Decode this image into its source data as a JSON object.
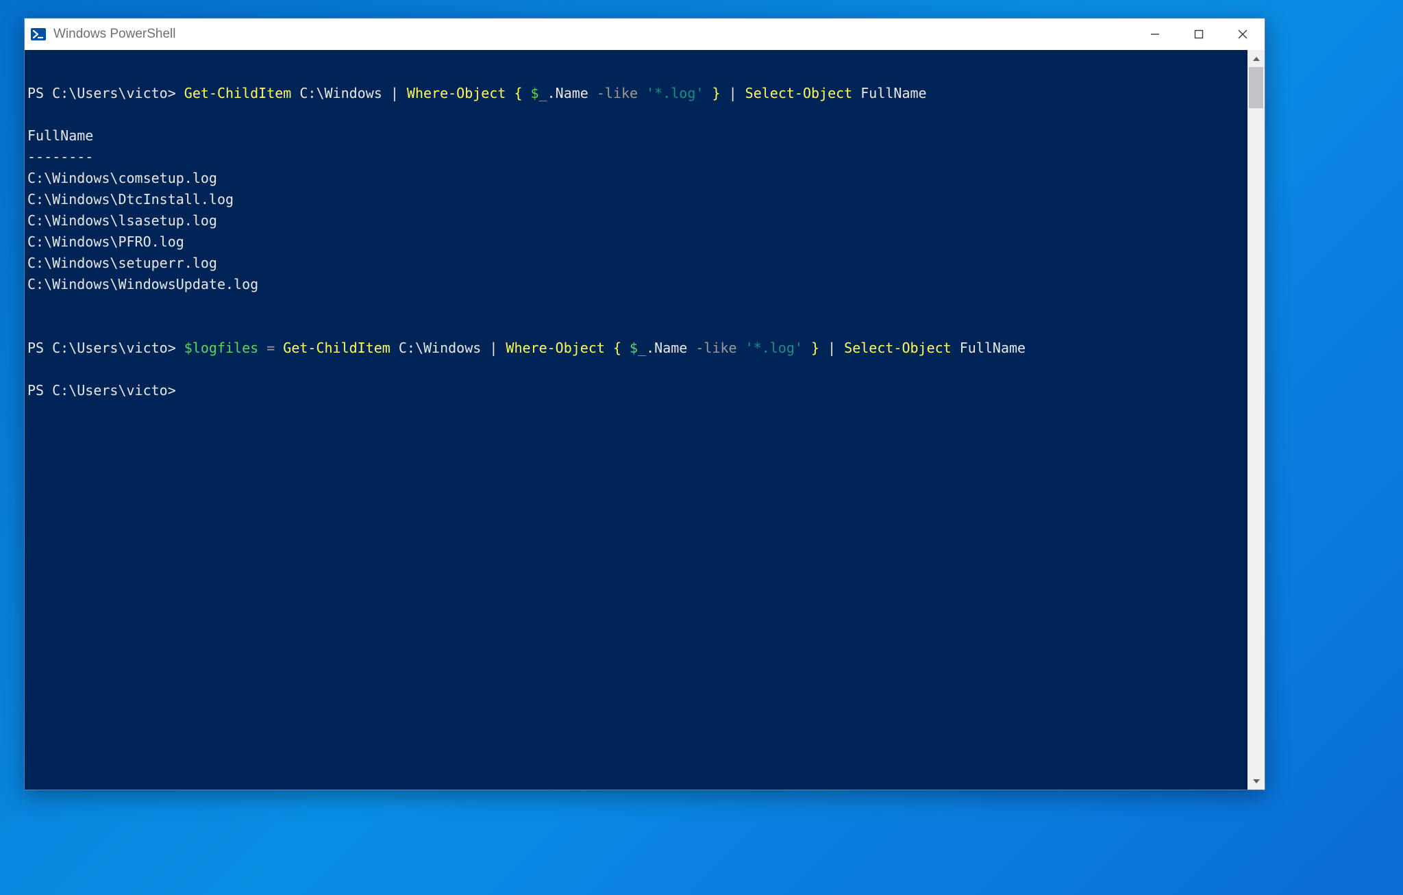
{
  "window": {
    "title": "Windows PowerShell"
  },
  "terminal": {
    "line1": {
      "prompt": "PS C:\\Users\\victo> ",
      "cmd1": "Get-ChildItem",
      "arg1": " C:\\Windows ",
      "pipe1": "| ",
      "cmd2": "Where-Object",
      "brace_open": " { ",
      "var1": "$_",
      "member": ".Name ",
      "op1": "-like ",
      "str1": "'*.log'",
      "brace_close": " } ",
      "pipe2": "| ",
      "cmd3": "Select-Object",
      "arg2": " FullName"
    },
    "output_header": "FullName",
    "output_divider": "--------",
    "output_rows": [
      "C:\\Windows\\comsetup.log",
      "C:\\Windows\\DtcInstall.log",
      "C:\\Windows\\lsasetup.log",
      "C:\\Windows\\PFRO.log",
      "C:\\Windows\\setuperr.log",
      "C:\\Windows\\WindowsUpdate.log"
    ],
    "line2": {
      "prompt": "PS C:\\Users\\victo> ",
      "var0": "$logfiles",
      "assign": " = ",
      "cmd1": "Get-ChildItem",
      "arg1": " C:\\Windows ",
      "pipe1": "| ",
      "cmd2": "Where-Object",
      "brace_open": " { ",
      "var1": "$_",
      "member": ".Name ",
      "op1": "-like ",
      "str1": "'*.log'",
      "brace_close": " } ",
      "pipe2": "| ",
      "cmd3": "Select-Object",
      "arg2": " FullName"
    },
    "line3_prompt": "PS C:\\Users\\victo> "
  }
}
